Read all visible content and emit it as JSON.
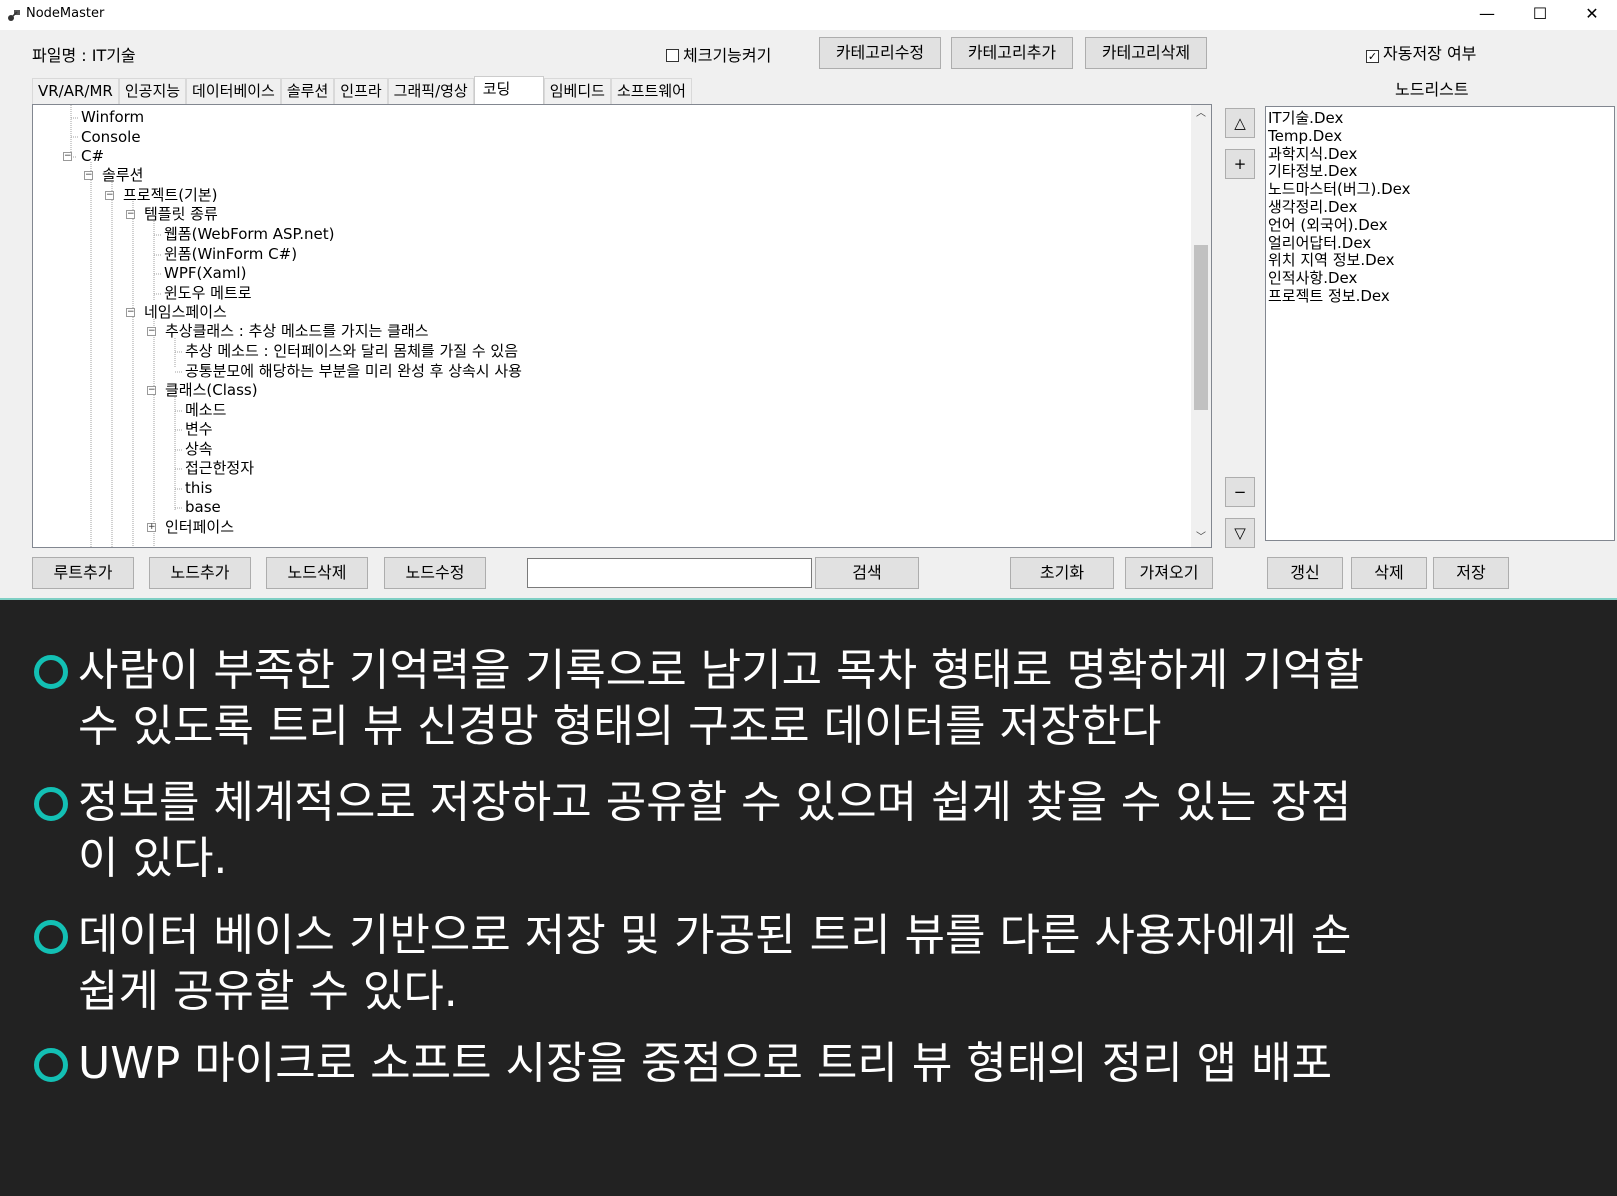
{
  "window": {
    "title": "NodeMaster",
    "controls": {
      "minimize": "—",
      "maximize": "☐",
      "close": "✕"
    }
  },
  "toolbar": {
    "file_label": "파일명 : IT기술",
    "check_feature": "체크기능켜기",
    "edit_category": "카테고리수정",
    "add_category": "카테고리추가",
    "delete_category": "카테고리삭제",
    "autosave": "자동저장 여부"
  },
  "tabs": [
    "VR/AR/MR",
    "인공지능",
    "데이터베이스",
    "솔루션",
    "인프라",
    "그래픽/영상",
    "코딩",
    "임베디드",
    "소프트웨어"
  ],
  "active_tab": "코딩",
  "tree": {
    "nodes": [
      "Winform",
      "Console",
      "C#",
      "솔루션",
      "프로젝트(기본)",
      "템플릿 종류",
      "웹폼(WebForm ASP.net)",
      "윈폼(WinForm C#)",
      "WPF(Xaml)",
      "윈도우 메트로",
      "네임스페이스",
      "추상클래스 : 추상 메소드를 가지는 클래스",
      "추상 메소드 : 인터페이스와 달리 몸체를 가질 수 있음",
      "공통분모에 해당하는 부분을 미리 완성 후 상속시 사용",
      "클래스(Class)",
      "메소드",
      "변수",
      "상속",
      "접근한정자",
      "this",
      "base",
      "인터페이스"
    ]
  },
  "side_buttons": {
    "up": "△",
    "plus": "+",
    "minus": "−",
    "down": "▽"
  },
  "nodelist": {
    "title": "노드리스트",
    "items": [
      "IT기술.Dex",
      "Temp.Dex",
      "과학지식.Dex",
      "기타정보.Dex",
      "노드마스터(버그).Dex",
      "생각정리.Dex",
      "언어 (외국어).Dex",
      "얼리어답터.Dex",
      "위치 지역 정보.Dex",
      "인적사항.Dex",
      "프로젝트 정보.Dex"
    ]
  },
  "bottom_buttons": {
    "add_root": "루트추가",
    "add_node": "노드추가",
    "delete_node": "노드삭제",
    "edit_node": "노드수정",
    "search": "검색",
    "reset": "초기화",
    "import": "가져오기",
    "refresh": "갱신",
    "delete": "삭제",
    "save": "저장"
  },
  "search": {
    "value": ""
  },
  "bullets": [
    {
      "line1": "사람이 부족한 기억력을 기록으로 남기고 목차 형태로 명확하게 기억할",
      "line2": "수 있도록 트리 뷰 신경망 형태의 구조로 데이터를 저장한다"
    },
    {
      "line1": " 정보를 체계적으로 저장하고 공유할 수 있으며 쉽게 찾을 수 있는 장점",
      "line2": "이 있다."
    },
    {
      "line1": "데이터 베이스 기반으로 저장 및 가공된 트리 뷰를 다른 사용자에게 손",
      "line2": "쉽게 공유할 수 있다."
    },
    {
      "line1": "UWP 마이크로 소프트 시장을 중점으로 트리 뷰 형태의 정리 앱 배포",
      "line2": ""
    }
  ],
  "colors": {
    "accent_ring": "#13c0b4",
    "panel_bg": "#222222",
    "window_bg": "#f0f0f0"
  }
}
